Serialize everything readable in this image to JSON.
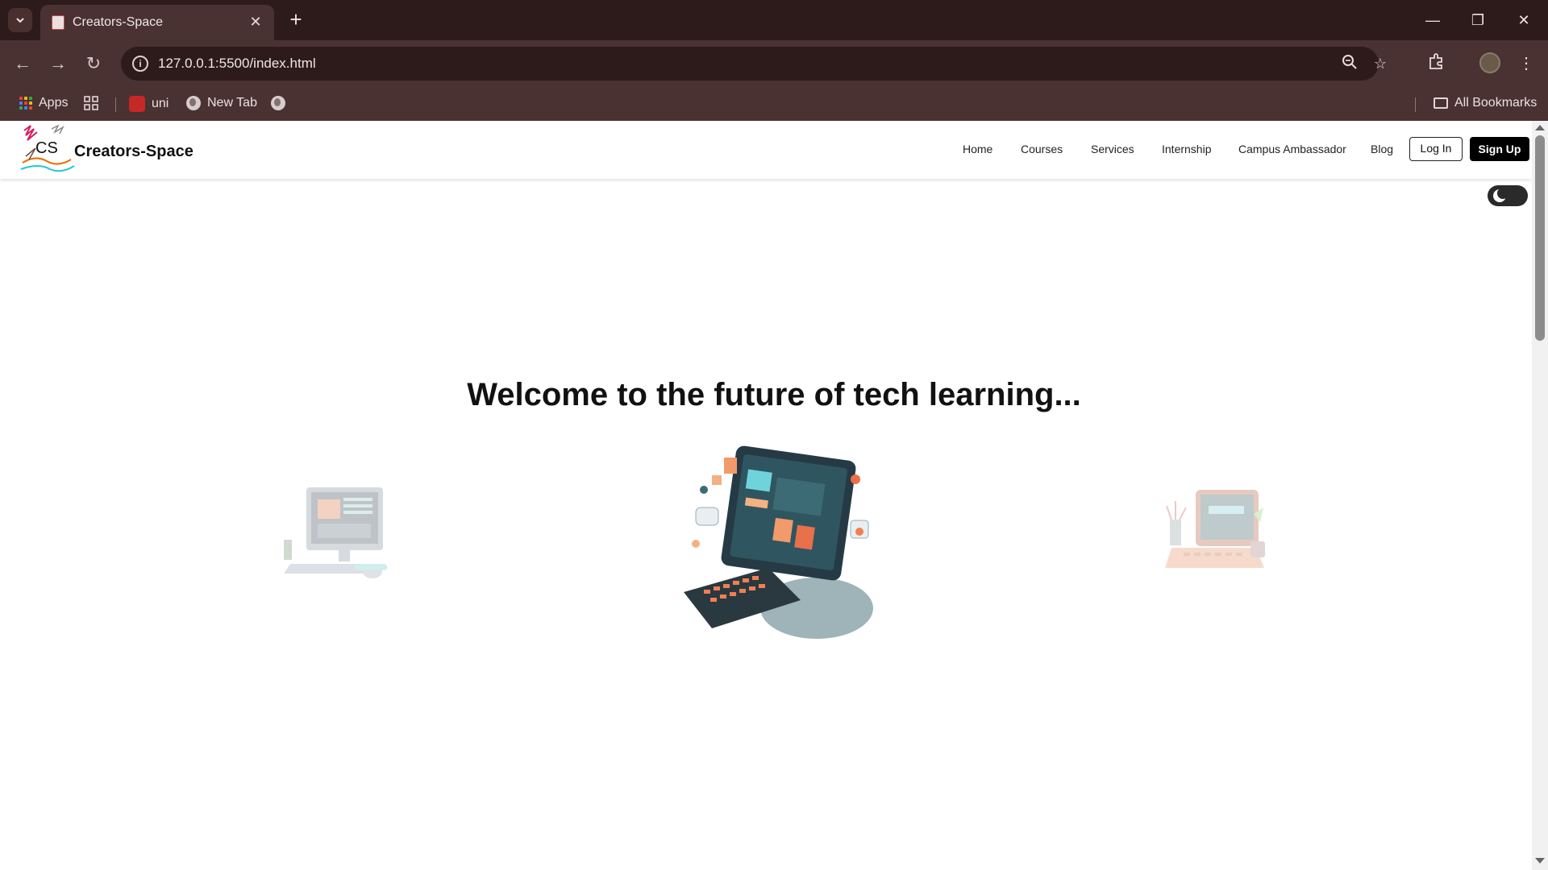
{
  "browser": {
    "tab_title": "Creators-Space",
    "url": "127.0.0.1:5500/index.html",
    "bookmarks": {
      "apps_label": "Apps",
      "uni_label": "uni",
      "new_tab_label": "New Tab",
      "all_bookmarks_label": "All Bookmarks"
    }
  },
  "site": {
    "logo_text": "CS",
    "brand": "Creators-Space",
    "nav": [
      "Home",
      "Courses",
      "Services",
      "Internship",
      "Campus Ambassador",
      "Blog"
    ],
    "login_label": "Log In",
    "signup_label": "Sign Up",
    "headline": "Welcome to the future of tech learning...",
    "theme_toggle": "dark-mode-toggle"
  },
  "colors": {
    "chrome_dark": "#2d1b1b",
    "chrome_mid": "#4a3232",
    "accent_black": "#000000"
  }
}
